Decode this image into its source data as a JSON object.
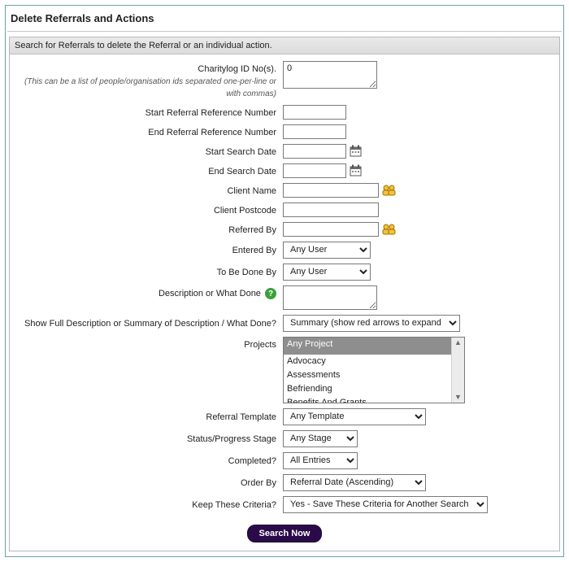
{
  "page_title": "Delete Referrals and Actions",
  "strip_text": "Search for Referrals to delete the Referral or an individual action.",
  "labels": {
    "ids": "Charitylog ID No(s).",
    "ids_hint": "(This can be a list of people/organisation ids separated one-per-line or with commas)",
    "start_ref": "Start Referral Reference Number",
    "end_ref": "End Referral Reference Number",
    "start_date": "Start Search Date",
    "end_date": "End Search Date",
    "client_name": "Client Name",
    "client_postcode": "Client Postcode",
    "referred_by": "Referred By",
    "entered_by": "Entered By",
    "to_be_done_by": "To Be Done By",
    "description": "Description or What Done",
    "full_desc": "Show Full Description or Summary of Description / What Done?",
    "projects": "Projects",
    "referral_template": "Referral Template",
    "status_stage": "Status/Progress Stage",
    "completed": "Completed?",
    "order_by": "Order By",
    "keep_criteria": "Keep These Criteria?"
  },
  "values": {
    "ids": "0",
    "start_ref": "",
    "end_ref": "",
    "start_date": "",
    "end_date": "",
    "client_name": "",
    "client_postcode": "",
    "referred_by": "",
    "description": "",
    "entered_by": "Any User",
    "to_be_done_by": "Any User",
    "full_desc": "Summary (show red arrows to expand text)",
    "referral_template": "Any Template",
    "status_stage": "Any Stage",
    "completed": "All Entries",
    "order_by": "Referral Date (Ascending)",
    "keep_criteria": "Yes - Save These Criteria for Another Search"
  },
  "projects": {
    "selected": "Any Project",
    "options": [
      "Any Project",
      "Advocacy",
      "Assessments",
      "Befriending",
      "Benefits And Grants"
    ]
  },
  "buttons": {
    "search": "Search Now"
  }
}
